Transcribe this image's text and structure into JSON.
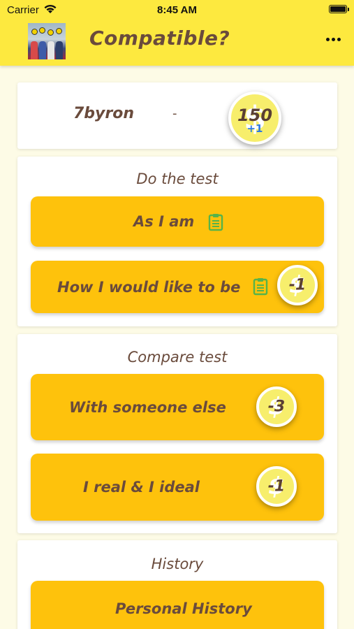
{
  "status": {
    "carrier": "Carrier",
    "time": "8:45 AM"
  },
  "header": {
    "title": "Compatible?"
  },
  "profile": {
    "username": "7byron",
    "separator": "-",
    "coins": "150",
    "coins_bonus": "+1"
  },
  "do_test": {
    "title": "Do the test",
    "as_i_am": "As I am",
    "would_like": "How I would like to be",
    "would_like_cost": "-1"
  },
  "compare": {
    "title": "Compare test",
    "someone_else": "With someone else",
    "someone_else_cost": "-3",
    "real_ideal": "I real & I ideal",
    "real_ideal_cost": "-1"
  },
  "history": {
    "title": "History",
    "personal": "Personal History"
  },
  "colors": {
    "header": "#fde93f",
    "button": "#fec20c",
    "text": "#6a4b3c",
    "clipboard": "#56b34a"
  }
}
